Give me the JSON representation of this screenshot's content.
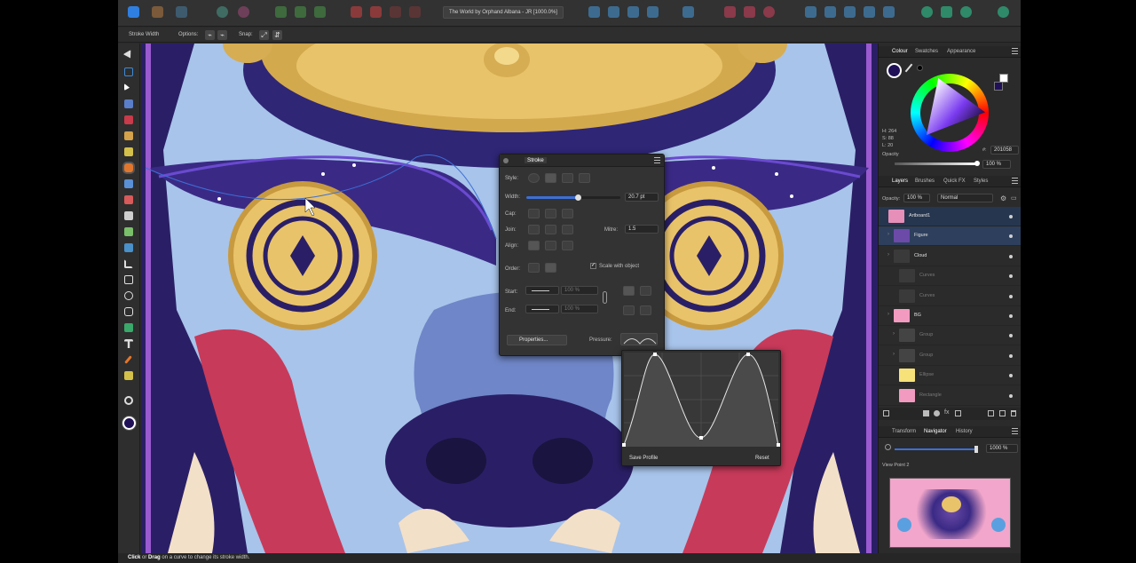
{
  "app": {
    "document_title": "The World by Orphand Albana - JR [1000.0%]",
    "colors": {
      "accent": "#2f7fe0",
      "panel": "#2b2b2b",
      "toolbar": "#323232"
    }
  },
  "context_toolbar": {
    "stroke_width_label": "Stroke Width",
    "options_label": "Options:",
    "snap_label": "Snap:"
  },
  "status_bar": {
    "click": "Click",
    "or": "or",
    "drag": "Drag",
    "rest": "on a curve to change its stroke width."
  },
  "colour_panel": {
    "tabs": [
      "Colour",
      "Swatches",
      "Appearance"
    ],
    "h": "H: 264",
    "s": "S: 88",
    "l": "L: 20",
    "hex_prefix": "#:",
    "hex": "201058",
    "opacity_label": "Opacity",
    "opacity_value": "100 %"
  },
  "layers_panel": {
    "tabs": [
      "Layers",
      "Brushes",
      "Quick FX",
      "Styles"
    ],
    "opacity_label": "Opacity:",
    "opacity_value": "100 %",
    "blend_mode": "Normal",
    "layers": [
      {
        "name": "Artboard1",
        "thumb": "#e58fb9",
        "selected": true,
        "dim": false
      },
      {
        "name": "Figure",
        "thumb": "#6b4aa8",
        "selected": true,
        "dim": false
      },
      {
        "name": "Cloud",
        "thumb": "#3a3a3a",
        "selected": false,
        "dim": false
      },
      {
        "name": "Curves",
        "thumb": "#3a3a3a",
        "selected": false,
        "dim": true
      },
      {
        "name": "Curves",
        "thumb": "#3a3a3a",
        "selected": false,
        "dim": true
      },
      {
        "name": "BG",
        "thumb": "#f29ac0",
        "selected": false,
        "dim": false
      },
      {
        "name": "Group",
        "thumb": "#444444",
        "selected": false,
        "dim": true
      },
      {
        "name": "Group",
        "thumb": "#444444",
        "selected": false,
        "dim": true
      },
      {
        "name": "Ellipse",
        "thumb": "#f7e27a",
        "selected": false,
        "dim": true
      },
      {
        "name": "Rectangle",
        "thumb": "#f29ac0",
        "selected": false,
        "dim": true
      }
    ]
  },
  "navigator_panel": {
    "tabs": [
      "Transform",
      "Navigator",
      "History"
    ],
    "zoom": "1000 %",
    "view_point": "View Point 2"
  },
  "stroke_panel": {
    "title": "Stroke",
    "style_label": "Style:",
    "width_label": "Width:",
    "width_value": "20.7 pt",
    "width_fraction": 0.55,
    "cap_label": "Cap:",
    "join_label": "Join:",
    "mitre_label": "Mitre:",
    "mitre_value": "1.5",
    "align_label": "Align:",
    "order_label": "Order:",
    "scale_label": "Scale with object",
    "start_label": "Start:",
    "start_value": "100 %",
    "end_label": "End:",
    "end_value": "100 %",
    "properties_button": "Properties...",
    "pressure_label": "Pressure:"
  },
  "pressure_popup": {
    "save_button": "Save Profile",
    "reset_button": "Reset"
  }
}
